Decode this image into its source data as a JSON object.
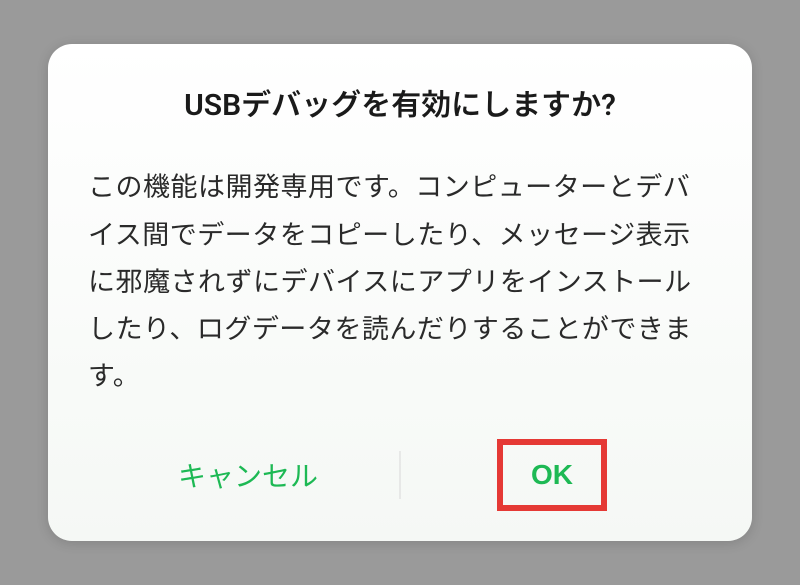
{
  "dialog": {
    "title": "USBデバッグを有効にしますか?",
    "body": "この機能は開発専用です。コンピューターとデバイス間でデータをコピーしたり、メッセージ表示に邪魔されずにデバイスにアプリをインストールしたり、ログデータを読んだりすることができます。",
    "cancel_label": "キャンセル",
    "ok_label": "OK"
  },
  "colors": {
    "accent": "#1db954",
    "highlight_border": "#e53935"
  }
}
